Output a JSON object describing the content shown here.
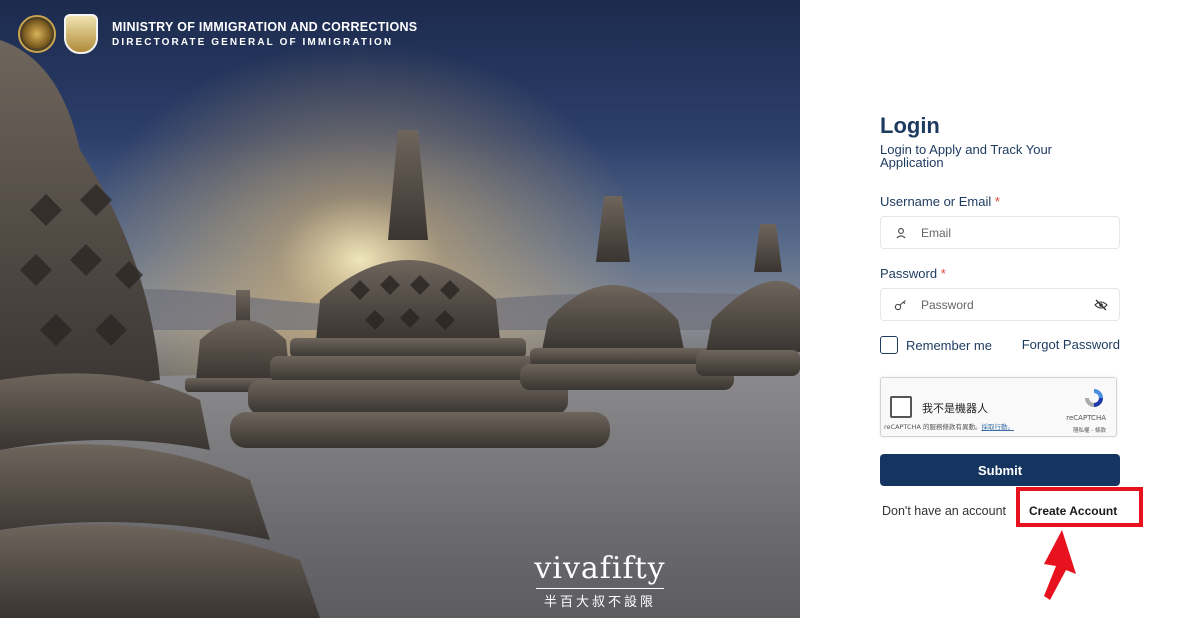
{
  "brand": {
    "line1": "MINISTRY OF IMMIGRATION AND CORRECTIONS",
    "line2": "DIRECTORATE GENERAL OF IMMIGRATION"
  },
  "watermark": {
    "main": "vivafifty",
    "sub": "半百大叔不設限"
  },
  "login": {
    "title": "Login",
    "subtitle": "Login to Apply and Track Your Application",
    "username_label": "Username or Email",
    "username_placeholder": "Email",
    "password_label": "Password",
    "password_placeholder": "Password",
    "required_mark": "*",
    "remember_label": "Remember me",
    "forgot_label": "Forgot Password",
    "submit_label": "Submit",
    "no_account_text": "Don't have an account",
    "create_account_label": "Create Account"
  },
  "captcha": {
    "label": "我不是機器人",
    "legal_prefix": "reCAPTCHA 的服務條款有異動。",
    "legal_link": "採取行動。",
    "brand": "reCAPTCHA",
    "terms": "隱私權 - 條款"
  },
  "colors": {
    "primary": "#153560",
    "text_primary": "#1d3a5f",
    "required": "#d9453b",
    "annotation": "#e8121e"
  },
  "icons": [
    "user-icon",
    "key-icon",
    "eye-off-icon",
    "recaptcha-icon",
    "arrow-up-icon"
  ]
}
